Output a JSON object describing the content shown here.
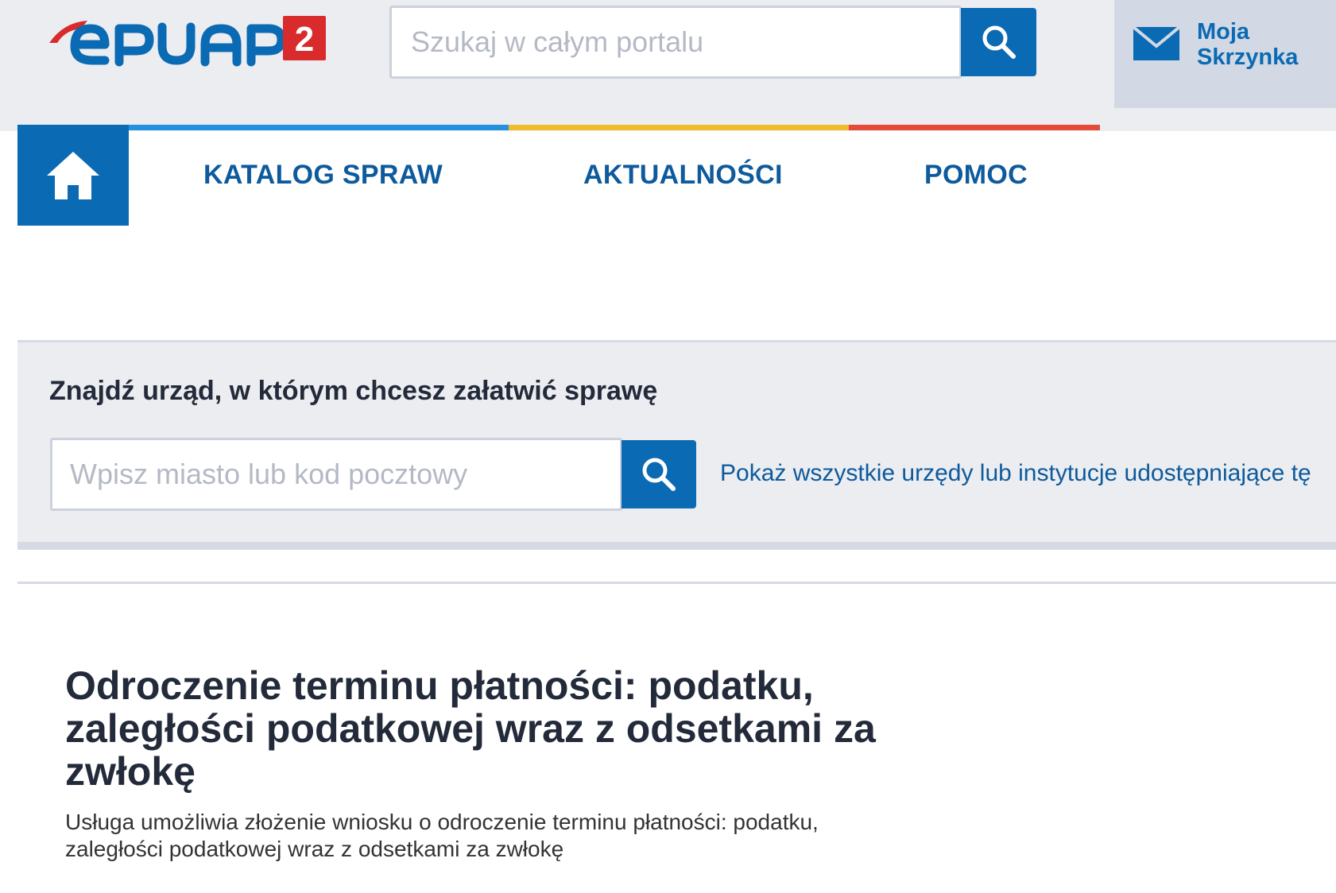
{
  "header": {
    "logo": {
      "text": "ePUAP",
      "badge": "2",
      "colors": {
        "text": "#0a6ab3",
        "swoosh": "#d92b2b",
        "badge_bg": "#d92b2b"
      }
    },
    "search": {
      "placeholder": "Szukaj w całym portalu",
      "button_icon": "search-icon"
    },
    "mailbox": {
      "label": "Moja\nSkrzynka",
      "icon": "envelope-icon"
    }
  },
  "nav": {
    "home_icon": "home-icon",
    "items": [
      {
        "label": "KATALOG SPRAW"
      },
      {
        "label": "AKTUALNOŚCI"
      },
      {
        "label": "POMOC"
      }
    ],
    "accent_colors": [
      "#2490df",
      "#f1bc2b",
      "#e5493a"
    ]
  },
  "office_finder": {
    "title": "Znajdź urząd, w którym chcesz załatwić sprawę",
    "input_placeholder": "Wpisz miasto lub kod pocztowy",
    "button_icon": "search-icon",
    "show_all_link": "Pokaż wszystkie urzędy lub instytucje udostępniające tę"
  },
  "service": {
    "title": "Odroczenie terminu płatności: podatku, zaległości podatkowej wraz z odsetkami za zwłokę",
    "description": "Usługa umożliwia złożenie wniosku o odroczenie terminu płatności: podatku, zaległości podatkowej wraz z odsetkami za zwłokę"
  },
  "theme": {
    "primary": "#0a6ab3",
    "link": "#0d5a9c",
    "header_bg": "#ecedf1",
    "heading_text": "#232a3a"
  }
}
